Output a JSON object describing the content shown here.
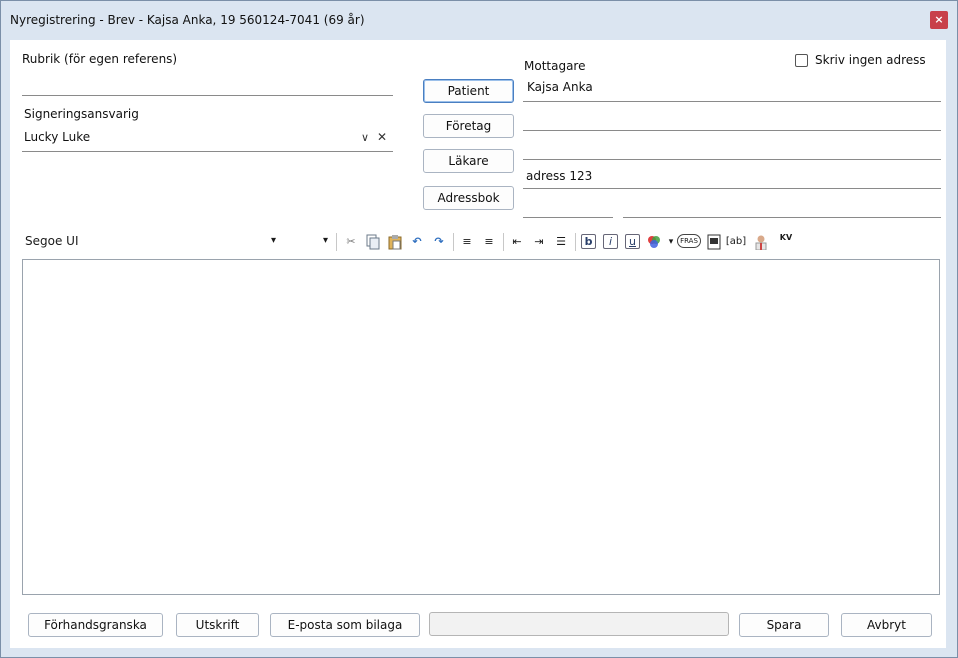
{
  "window": {
    "title": "Nyregistrering - Brev - Kajsa Anka, 19 560124-7041 (69 år)",
    "close_glyph": "×"
  },
  "left": {
    "rubrik_label": "Rubrik (för egen referens)",
    "rubrik_value": "",
    "sign_label": "Signeringsansvarig",
    "sign_value": "Lucky Luke",
    "dropdown_glyph": "∨",
    "clear_glyph": "✕"
  },
  "recipient_buttons": {
    "patient": "Patient",
    "foretag": "Företag",
    "lakare": "Läkare",
    "adressbok": "Adressbok"
  },
  "recipient": {
    "label": "Mottagare",
    "no_address_label": "Skriv ingen adress",
    "no_address_checked": false,
    "line1": "Kajsa Anka",
    "line2": "",
    "line3": "",
    "line4": "adress 123",
    "postcode": "",
    "city": ""
  },
  "toolbar": {
    "font_name": "Segoe UI",
    "font_size": "",
    "dropdown_arrow": "▾",
    "icons": [
      "cut-icon",
      "copy-icon",
      "paste-icon",
      "undo-icon",
      "redo-icon",
      "align-left-icon",
      "align-right-icon",
      "outdent-icon",
      "indent-icon",
      "bullet-list-icon",
      "bold-icon",
      "italic-icon",
      "underline-icon",
      "color-icon",
      "phrase-icon",
      "template-icon",
      "field-icon",
      "doctor-icon",
      "kv-icon"
    ],
    "bold_glyph": "b",
    "italic_glyph": "i",
    "underline_glyph": "u",
    "phrase_glyph": "FRAS",
    "field_glyph": "[ab]",
    "kv_glyph": "KV"
  },
  "footer": {
    "preview": "Förhandsgranska",
    "print": "Utskrift",
    "email": "E-posta som bilaga",
    "status": "",
    "save": "Spara",
    "cancel": "Avbryt"
  },
  "colors": {
    "frame": "#dbe5f1",
    "close": "#c8404a",
    "accent": "#4a7fc1"
  }
}
